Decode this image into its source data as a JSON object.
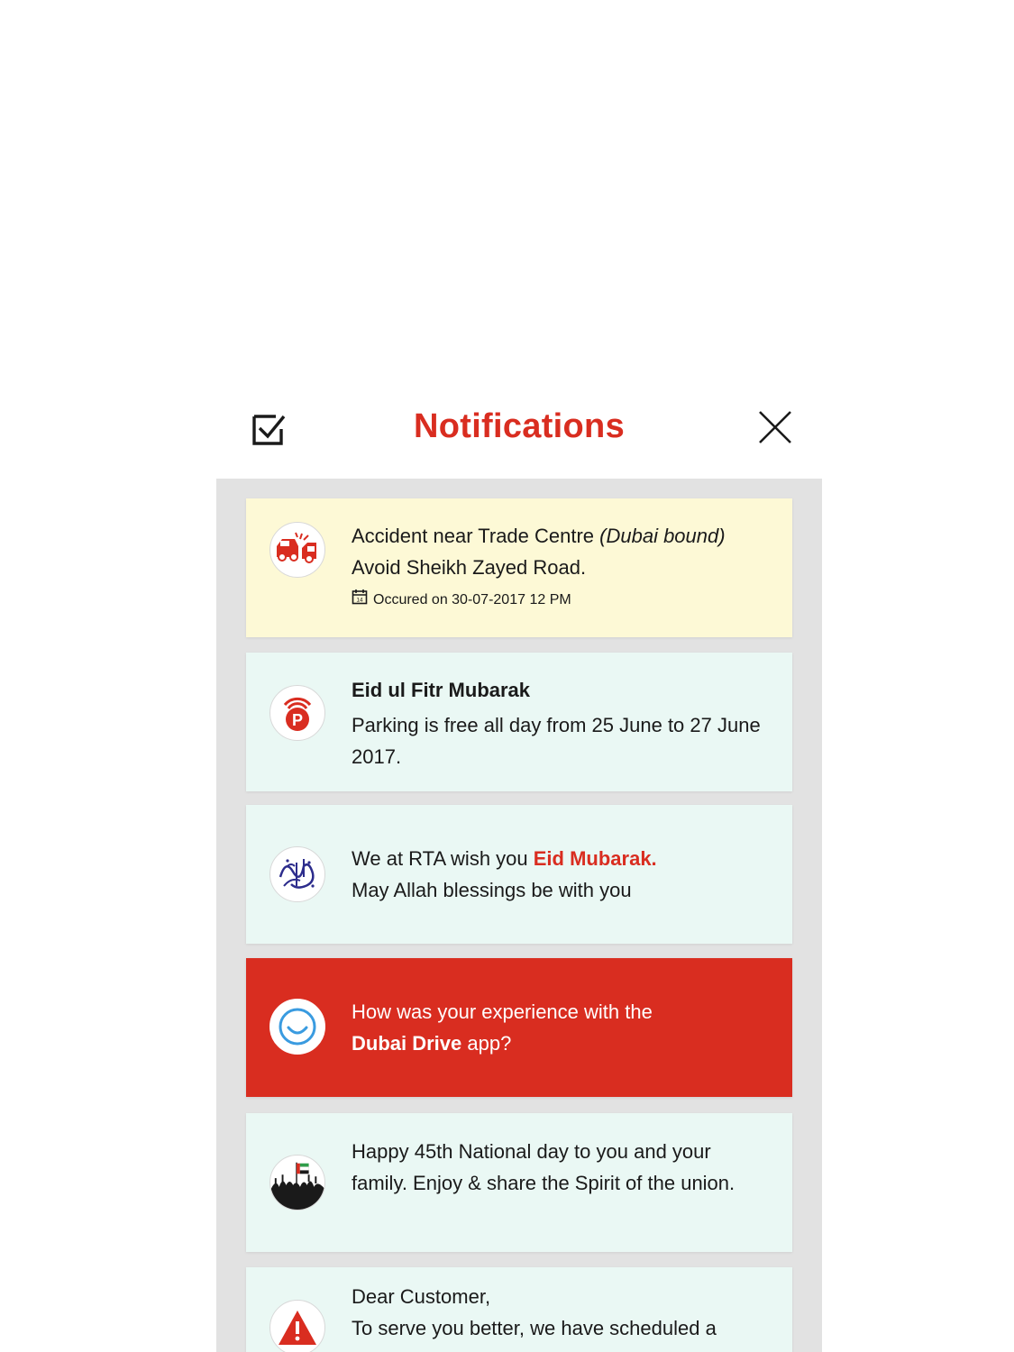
{
  "header": {
    "title": "Notifications"
  },
  "notifications": [
    {
      "line1_text": "Accident near Trade Centre ",
      "line1_italic": "(Dubai bound)",
      "line2": "Avoid Sheikh Zayed Road.",
      "date": "Occured on 30-07-2017 12 PM",
      "icon": "car-accident-icon",
      "bg": "#fdf9d6"
    },
    {
      "title": "Eid ul Fitr Mubarak",
      "body": "Parking is free all day from 25 June to 27 June 2017.",
      "icon": "parking-icon",
      "bg": "#eaf8f4"
    },
    {
      "line1_text": "We at RTA wish you ",
      "line1_accent": "Eid Mubarak.",
      "line2": "May Allah blessings be with you",
      "icon": "eid-calligraphy-icon",
      "bg": "#eaf8f4"
    },
    {
      "line1": "How was your experience with the",
      "line2_bold": "Dubai Drive",
      "line2_text": " app?",
      "icon": "smiley-icon",
      "bg": "#d92d20"
    },
    {
      "body": "Happy 45th National day to you and your family. Enjoy & share the Spirit of the union.",
      "icon": "uae-flag-crowd-icon",
      "bg": "#eaf8f4"
    },
    {
      "line1": "Dear Customer,",
      "line2": "To serve you better, we have scheduled a",
      "icon": "warning-icon",
      "bg": "#eaf8f4"
    }
  ],
  "colors": {
    "accent": "#d92d20",
    "panel": "#e2e2e2",
    "yellow_card": "#fdf9d6",
    "mint_card": "#eaf8f4"
  }
}
